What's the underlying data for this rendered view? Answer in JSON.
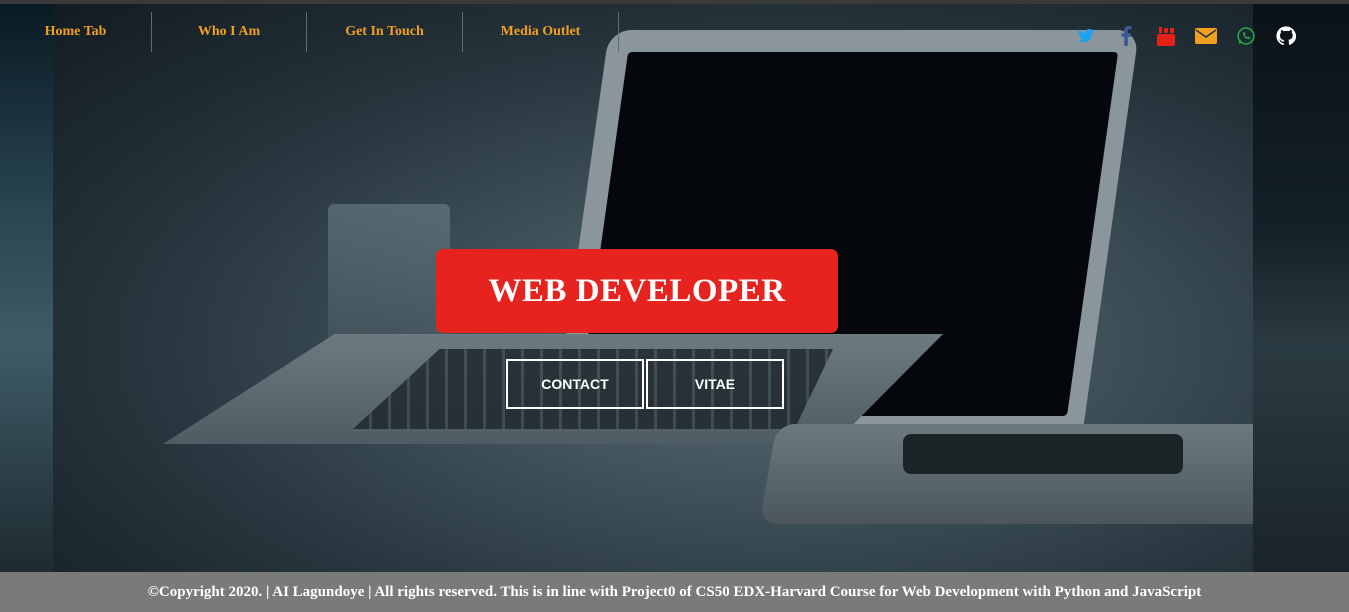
{
  "nav": {
    "items": [
      {
        "label": "Home Tab"
      },
      {
        "label": "Who I Am"
      },
      {
        "label": "Get In Touch"
      },
      {
        "label": "Media Outlet"
      }
    ]
  },
  "social": {
    "icons": [
      "twitter-icon",
      "facebook-icon",
      "youtube-icon",
      "email-icon",
      "whatsapp-icon",
      "github-icon"
    ],
    "colors": {
      "twitter": "#1da1f2",
      "facebook": "#3b5998",
      "youtube": "#e62117",
      "email": "#f0a020",
      "whatsapp": "#25a244",
      "github": "#ffffff"
    }
  },
  "hero": {
    "title": "WEB DEVELOPER",
    "contact_label": "CONTACT",
    "vitae_label": "VITAE"
  },
  "footer": {
    "text": "©Copyright 2020. | AI Lagundoye | All rights reserved. This is in line with Project0 of CS50 EDX-Harvard Course for Web Development with Python and JavaScript"
  },
  "colors": {
    "accent": "#e6231e",
    "nav_text": "#f0a020",
    "footer_bg": "#7a7a7a"
  }
}
